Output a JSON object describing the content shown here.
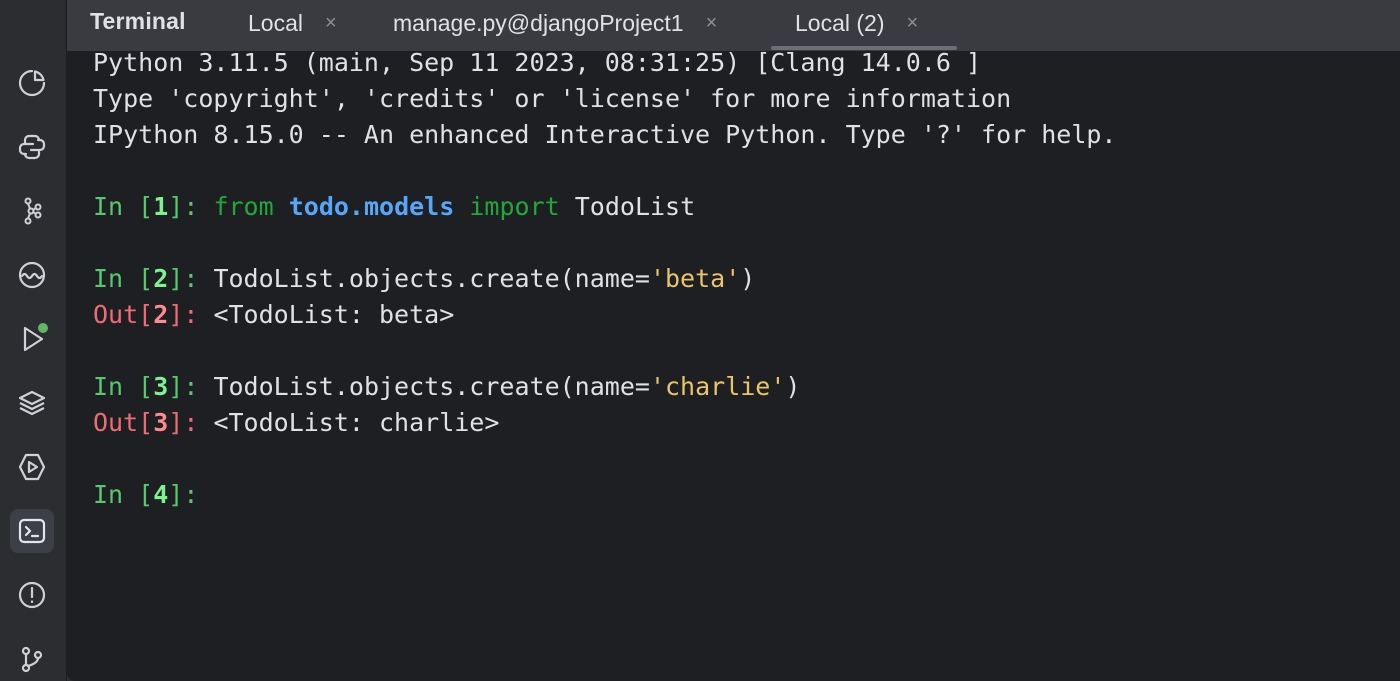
{
  "window": {
    "tool_title": "Terminal",
    "tabs": [
      {
        "label": "Local",
        "close": "×"
      },
      {
        "label": "manage.py@djangoProject1",
        "close": "×"
      },
      {
        "label": "Local (2)",
        "close": "×",
        "selected": true
      }
    ]
  },
  "toolstrip": {
    "items": [
      {
        "icon": "profiler-icon"
      },
      {
        "icon": "python-console-icon"
      },
      {
        "icon": "services-graph-icon"
      },
      {
        "icon": "monitor-wave-icon"
      },
      {
        "icon": "run-icon",
        "badge": "running"
      },
      {
        "icon": "layers-icon"
      },
      {
        "icon": "debug-run-icon"
      },
      {
        "icon": "terminal-icon",
        "active": true
      },
      {
        "icon": "problems-icon"
      },
      {
        "icon": "git-icon"
      }
    ]
  },
  "terminal": {
    "banner": [
      "Python 3.11.5 (main, Sep 11 2023, 08:31:25) [Clang 14.0.6 ]",
      "Type 'copyright', 'credits' or 'license' for more information",
      "IPython 8.15.0 -- An enhanced Interactive Python. Type '?' for help."
    ],
    "cells": [
      {
        "in_prefix": "In [",
        "in_num": "1",
        "in_suffix": "]: ",
        "tokens": {
          "kw1": "from",
          "module": "todo.models",
          "kw2": "import",
          "name": "TodoList"
        }
      },
      {
        "in_prefix": "In [",
        "in_num": "2",
        "in_suffix": "]: ",
        "code_pre": "TodoList.objects.create(name=",
        "code_str": "'beta'",
        "code_post": ")",
        "out_prefix": "Out[",
        "out_num": "2",
        "out_suffix": "]: ",
        "out_text": "<TodoList: beta>"
      },
      {
        "in_prefix": "In [",
        "in_num": "3",
        "in_suffix": "]: ",
        "code_pre": "TodoList.objects.create(name=",
        "code_str": "'charlie'",
        "code_post": ")",
        "out_prefix": "Out[",
        "out_num": "3",
        "out_suffix": "]: ",
        "out_text": "<TodoList: charlie>"
      },
      {
        "in_prefix": "In [",
        "in_num": "4",
        "in_suffix": "]: "
      }
    ]
  },
  "colors": {
    "in_prompt": "#56c96a",
    "out_prompt": "#f06b73",
    "keyword": "#21a83a",
    "module": "#57a6f9",
    "string": "#e9c46a",
    "terminal_bg": "#1e1f22"
  }
}
